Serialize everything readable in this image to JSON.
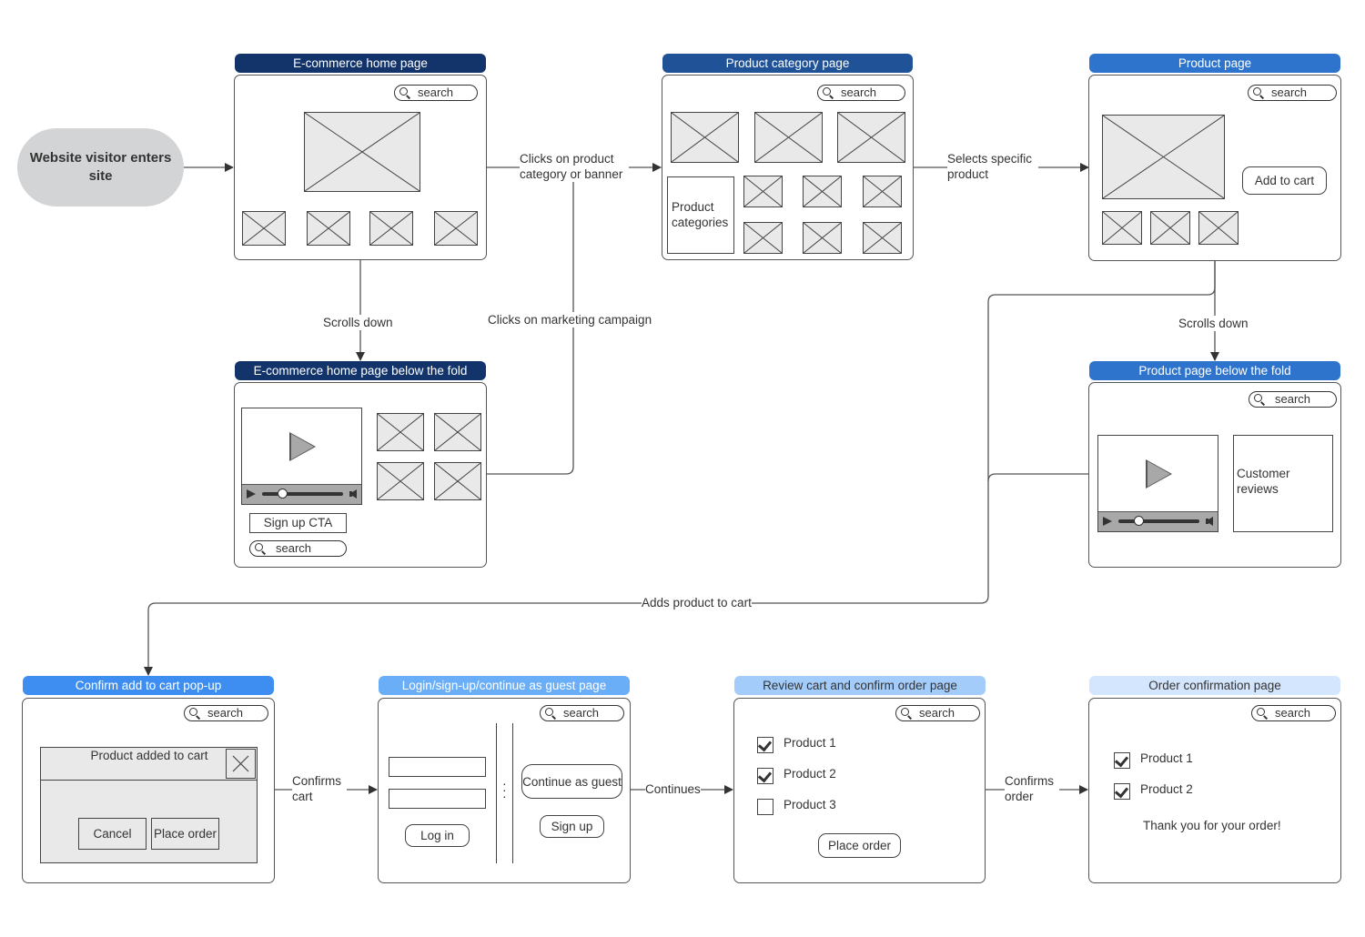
{
  "colors": {
    "navy": "#12346b",
    "dark_blue": "#1f5296",
    "mid_blue": "#2f74cc",
    "bright_blue": "#3d8ef0",
    "light_blue": "#6aaef7",
    "pale_blue": "#a3ccfb",
    "paler_blue": "#d4e6fd",
    "start_node_fill": "#d3d4d6"
  },
  "start_node": {
    "label": "Website visitor enters site"
  },
  "search_label": "search",
  "frames": {
    "home": {
      "title": "E-commerce home page"
    },
    "category": {
      "title": "Product category page",
      "categories_label": "Product categories"
    },
    "product": {
      "title": "Product page",
      "add_to_cart": "Add to cart"
    },
    "home_fold": {
      "title": "E-commerce home page below the fold",
      "signup_cta": "Sign up CTA"
    },
    "product_fold": {
      "title": "Product page below the fold",
      "reviews_label": "Customer reviews"
    },
    "confirm_popup": {
      "title": "Confirm add to cart pop-up",
      "dialog_title": "Product added to cart",
      "cancel": "Cancel",
      "place_order": "Place order"
    },
    "login": {
      "title": "Login/sign-up/continue as guest page",
      "login": "Log in",
      "guest": "Continue as guest",
      "signup": "Sign up"
    },
    "review": {
      "title": "Review cart and confirm order page",
      "items": [
        {
          "label": "Product 1",
          "checked": true
        },
        {
          "label": "Product 2",
          "checked": true
        },
        {
          "label": "Product 3",
          "checked": false
        }
      ],
      "place_order": "Place order"
    },
    "confirmation": {
      "title": "Order confirmation page",
      "items": [
        {
          "label": "Product 1",
          "checked": true
        },
        {
          "label": "Product 2",
          "checked": true
        }
      ],
      "thanks": "Thank you for your order!"
    }
  },
  "edges": {
    "clicks_category": "Clicks on product category or banner",
    "selects_product": "Selects specific product",
    "scrolls_down_home": "Scrolls down",
    "clicks_campaign": "Clicks on marketing campaign",
    "scrolls_down_product": "Scrolls down",
    "adds_to_cart": "Adds product to cart",
    "confirms_cart": "Confirms cart",
    "continues": "Continues",
    "confirms_order": "Confirms order"
  }
}
